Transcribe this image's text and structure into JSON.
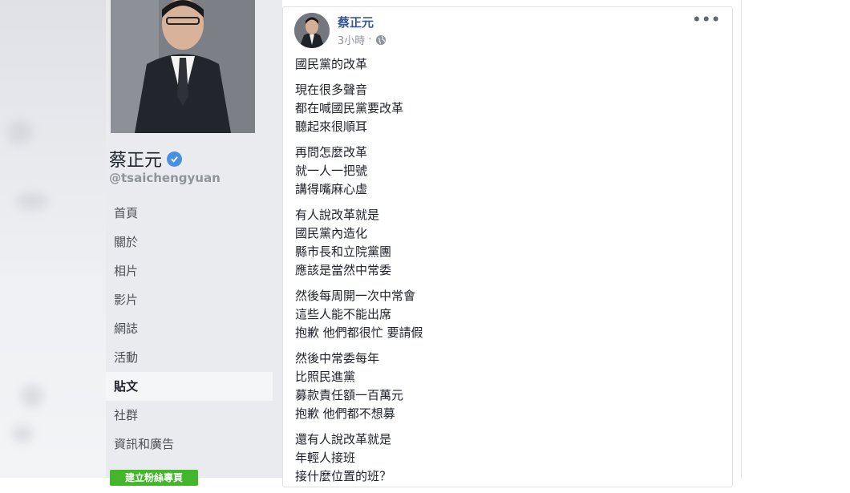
{
  "page": {
    "name": "蔡正元",
    "handle": "@tsaichengyuan",
    "nav": [
      {
        "label": "首頁"
      },
      {
        "label": "關於"
      },
      {
        "label": "相片"
      },
      {
        "label": "影片"
      },
      {
        "label": "網誌"
      },
      {
        "label": "活動"
      },
      {
        "label": "貼文",
        "active": true
      },
      {
        "label": "社群"
      },
      {
        "label": "資訊和廣告"
      }
    ],
    "cta_label": "建立粉絲專頁"
  },
  "post": {
    "author": "蔡正元",
    "time": "3小時",
    "separator": "·",
    "stanzas": [
      [
        "國民黨的改革"
      ],
      [
        "現在很多聲音",
        "都在喊國民黨要改革",
        "聽起來很順耳"
      ],
      [
        "再問怎麼改革",
        "就一人一把號",
        "講得嘴麻心虛"
      ],
      [
        "有人說改革就是",
        "國民黨內造化",
        "縣市長和立院黨團",
        "應該是當然中常委"
      ],
      [
        "然後每周開一次中常會",
        "這些人能不能出席",
        "抱歉 他們都很忙 要請假"
      ],
      [
        "然後中常委每年",
        "比照民進黨",
        "募款責任額一百萬元",
        "抱歉 他們都不想募"
      ],
      [
        "還有人說改革就是",
        "年輕人接班",
        "接什麼位置的班？"
      ]
    ]
  },
  "icons": {
    "verified": "verified-badge-icon",
    "globe": "globe-icon",
    "more": "more-options-icon"
  },
  "colors": {
    "link": "#365899",
    "verified": "#4a90e2",
    "cta": "#42b72a"
  }
}
